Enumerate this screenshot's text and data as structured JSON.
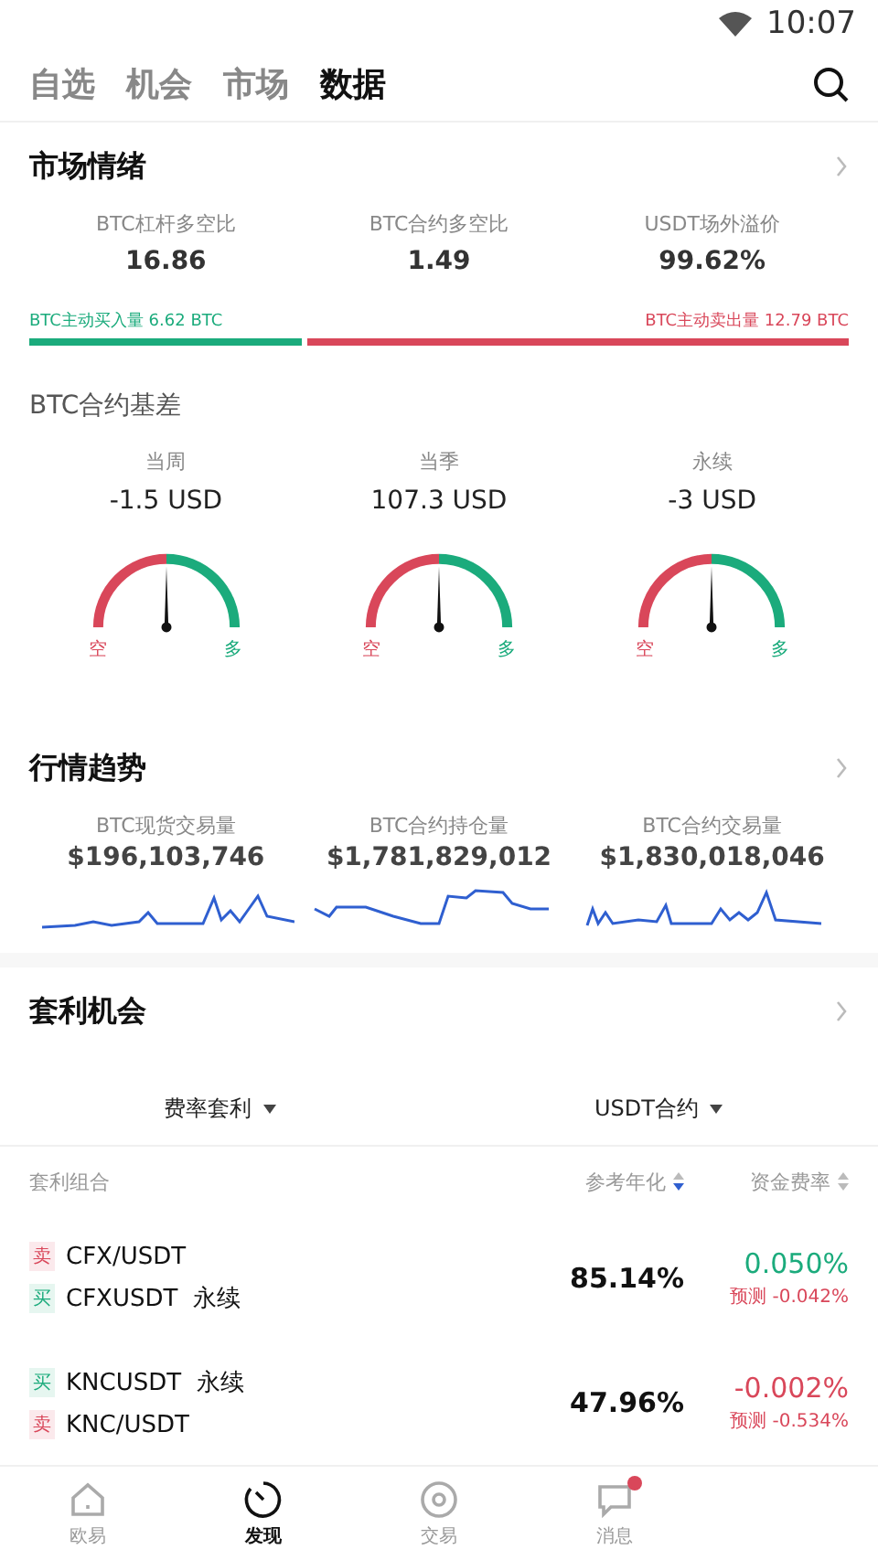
{
  "status_bar": {
    "time": "10:07"
  },
  "top_tabs": [
    {
      "label": "自选",
      "selected": false
    },
    {
      "label": "机会",
      "selected": false
    },
    {
      "label": "市场",
      "selected": false
    },
    {
      "label": "数据",
      "selected": true
    }
  ],
  "sentiment": {
    "title": "市场情绪",
    "stats": [
      {
        "label": "BTC杠杆多空比",
        "value": "16.86"
      },
      {
        "label": "BTC合约多空比",
        "value": "1.49"
      },
      {
        "label": "USDT场外溢价",
        "value": "99.62%"
      }
    ],
    "buy_label": "BTC主动买入量 6.62 BTC",
    "sell_label": "BTC主动卖出量 12.79 BTC",
    "level": 0.34
  },
  "basis": {
    "title": "BTC合约基差",
    "gauges": [
      {
        "label": "当周",
        "value": "-1.5 USD",
        "short": "空",
        "long": "多"
      },
      {
        "label": "当季",
        "value": "107.3 USD",
        "short": "空",
        "long": "多"
      },
      {
        "label": "永续",
        "value": "-3 USD",
        "short": "空",
        "long": "多"
      }
    ]
  },
  "trend": {
    "title": "行情趋势",
    "items": [
      {
        "label": "BTC现货交易量",
        "value": "$196,103,746"
      },
      {
        "label": "BTC合约持仓量",
        "value": "$1,781,829,012"
      },
      {
        "label": "BTC合约交易量",
        "value": "$1,830,018,046"
      }
    ]
  },
  "arbitrage": {
    "title": "套利机会",
    "filters": [
      "费率套利",
      "USDT合约"
    ],
    "columns": [
      {
        "label": "套利组合",
        "kind": "plain"
      },
      {
        "label": "参考年化",
        "kind": "sortable",
        "selected": true
      },
      {
        "label": "资金费率",
        "kind": "sortable",
        "selected": false
      }
    ],
    "rows": [
      {
        "legs": [
          {
            "kind": "sell",
            "tag": "卖",
            "name": "CFX/USDT"
          },
          {
            "kind": "buy",
            "tag": "买",
            "name": "CFXUSDT  永续"
          }
        ],
        "annual": "85.14%",
        "rate": "0.050%",
        "color": "#1bab7c",
        "forecast": "预测 -0.042%"
      },
      {
        "legs": [
          {
            "kind": "buy",
            "tag": "买",
            "name": "KNCUSDT  永续"
          },
          {
            "kind": "sell",
            "tag": "卖",
            "name": "KNC/USDT"
          }
        ],
        "annual": "47.96%",
        "rate": "-0.002%",
        "color": "#d9475a",
        "forecast": "预测 -0.534%"
      }
    ]
  },
  "bottom_nav": [
    {
      "label": "欧易",
      "kind": "home",
      "selected": false,
      "badge": false
    },
    {
      "label": "发现",
      "kind": "discover",
      "selected": true,
      "badge": false
    },
    {
      "label": "交易",
      "kind": "trade",
      "selected": false,
      "badge": false
    },
    {
      "label": "消息",
      "kind": "message",
      "selected": false,
      "badge": true
    }
  ]
}
